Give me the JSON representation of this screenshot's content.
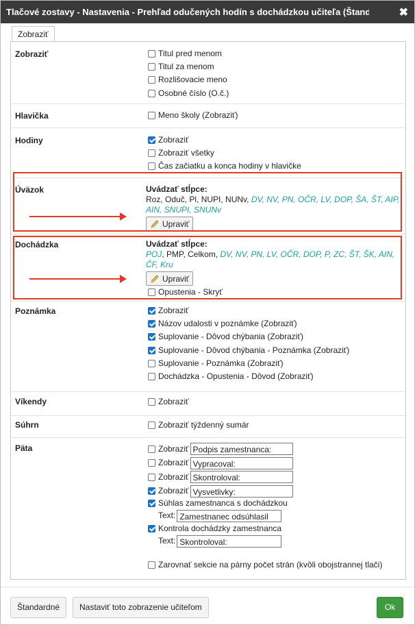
{
  "dialog": {
    "title": "Tlačové zostavy - Nastavenia - Prehľad odučených hodín s dochádzkou učiteľa (Štandar...",
    "close": "✖"
  },
  "tabs": [
    {
      "label": "Zobraziť"
    }
  ],
  "sections": {
    "zobrazit": {
      "label": "Zobraziť",
      "options": [
        {
          "label": "Titul pred menom",
          "checked": false
        },
        {
          "label": "Titul za menom",
          "checked": false
        },
        {
          "label": "Rozlišovacie meno",
          "checked": false
        },
        {
          "label": "Osobné číslo (O.č.)",
          "checked": false
        }
      ]
    },
    "hlavicka": {
      "label": "Hlavička",
      "options": [
        {
          "label": "Meno školy (Zobraziť)",
          "checked": false
        }
      ]
    },
    "hodiny": {
      "label": "Hodiny",
      "options": [
        {
          "label": "Zobraziť",
          "checked": true
        },
        {
          "label": "Zobraziť všetky",
          "checked": false
        },
        {
          "label": "Čas začiatku a konca hodiny v hlavičke",
          "checked": false
        }
      ]
    },
    "uvazok": {
      "label": "Úväzok",
      "columns_heading": "Uvádzať stĺpce:",
      "columns_plain": "Roz, Oduč, Pl, NUPI, NUNv, ",
      "columns_teal": "DV, NV, PN, OČR, LV, DOP, ŠA, ŠT, AIP, AIN, SNUPI, SNUNv",
      "edit_button": "Upraviť"
    },
    "dochadzka": {
      "label": "Dochádzka",
      "columns_heading": "Uvádzať stĺpce:",
      "columns_teal_1": "POJ",
      "columns_plain": ", PMP, Celkom, ",
      "columns_teal": "DV, NV, PN, LV, OČR, DOP, P, ZC, ŠT, ŠK, AIN, ČF, Kru",
      "edit_button": "Upraviť",
      "options": [
        {
          "label": "Opustenia - Skryť",
          "checked": false
        }
      ]
    },
    "poznamka": {
      "label": "Poznámka",
      "options": [
        {
          "label": "Zobraziť",
          "checked": true
        },
        {
          "label": "Názov udalosti v poznámke (Zobraziť)",
          "checked": true
        },
        {
          "label": "Suplovanie - Dôvod chýbania (Zobraziť)",
          "checked": true
        },
        {
          "label": "Suplovanie - Dôvod chýbania - Poznámka (Zobraziť)",
          "checked": true
        },
        {
          "label": "Suplovanie - Poznámka (Zobraziť)",
          "checked": false
        },
        {
          "label": "Dochádzka - Opustenia - Dôvod (Zobraziť)",
          "checked": false
        }
      ]
    },
    "vikendy": {
      "label": "Víkendy",
      "options": [
        {
          "label": "Zobraziť",
          "checked": false
        }
      ]
    },
    "suhrn": {
      "label": "Súhrn",
      "options": [
        {
          "label": "Zobraziť týždenný sumár",
          "checked": false
        }
      ]
    },
    "pata": {
      "label": "Päta",
      "fields": [
        {
          "label": "Zobraziť",
          "checked": false,
          "value": "Podpis zamestnanca:"
        },
        {
          "label": "Zobraziť",
          "checked": false,
          "value": "Vypracoval:"
        },
        {
          "label": "Zobraziť",
          "checked": false,
          "value": "Skontroloval:"
        },
        {
          "label": "Zobraziť",
          "checked": true,
          "value": "Vysvetlivky:"
        }
      ],
      "suhlas": {
        "label": "Súhlas zamestnanca s dochádzkou",
        "checked": true,
        "text_label": "Text:",
        "value": "Zamestnanec odsúhlasil"
      },
      "kontrola": {
        "label": "Kontrola dochádzky zamestnanca",
        "checked": true,
        "text_label": "Text:",
        "value": "Skontroloval:"
      },
      "zarovnat": {
        "label": "Zarovnať sekcie na párny počet strán (kvôli obojstrannej tlači)",
        "checked": false
      }
    }
  },
  "footer": {
    "standard": "Štandardné",
    "set_teachers": "Nastaviť toto zobrazenie učiteľom",
    "ok": "Ok"
  },
  "colors": {
    "highlight": "#e53a1e",
    "teal": "#1aa0a0",
    "ok": "#3d9a3d",
    "checkbox_on": "#1a73c8"
  }
}
